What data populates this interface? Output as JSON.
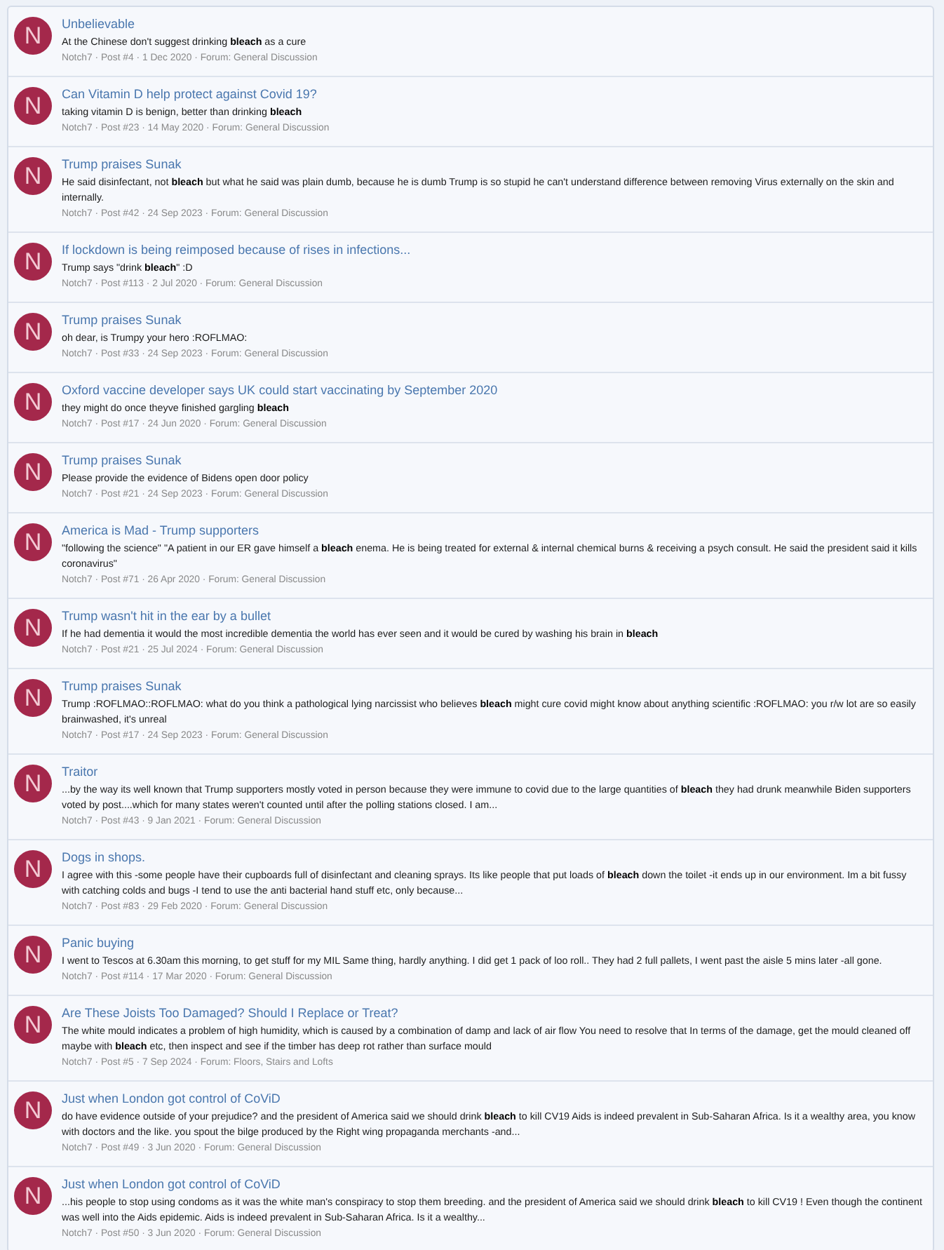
{
  "results": [
    {
      "avatar": "N",
      "title": "Unbelievable",
      "snippet": "At the Chinese don't suggest drinking **bleach** as a cure",
      "meta": "Notch7 · Post #4 · 1 Dec 2020 · Forum: General Discussion"
    },
    {
      "avatar": "N",
      "title": "Can Vitamin D help protect against Covid 19?",
      "snippet": "taking vitamin D is benign, better than drinking **bleach**",
      "meta": "Notch7 · Post #23 · 14 May 2020 · Forum: General Discussion"
    },
    {
      "avatar": "N",
      "title": "Trump praises Sunak",
      "snippet": "He said disinfectant, not **bleach** but what he said was plain dumb, because he is dumb Trump is so stupid he can't understand difference between removing Virus externally on the skin and internally.",
      "meta": "Notch7 · Post #42 · 24 Sep 2023 · Forum: General Discussion"
    },
    {
      "avatar": "N",
      "title": "If lockdown is being reimposed because of rises in infections...",
      "snippet": "Trump says \"drink **bleach**\" :D",
      "meta": "Notch7 · Post #113 · 2 Jul 2020 · Forum: General Discussion"
    },
    {
      "avatar": "N",
      "title": "Trump praises Sunak",
      "snippet": "oh dear, is Trumpy your hero :ROFLMAO:",
      "meta": "Notch7 · Post #33 · 24 Sep 2023 · Forum: General Discussion"
    },
    {
      "avatar": "N",
      "title": "Oxford vaccine developer says UK could start vaccinating by September 2020",
      "snippet": "they might do once theyve finished gargling **bleach**",
      "meta": "Notch7 · Post #17 · 24 Jun 2020 · Forum: General Discussion"
    },
    {
      "avatar": "N",
      "title": "Trump praises Sunak",
      "snippet": "Please provide the evidence of Bidens open door policy",
      "meta": "Notch7 · Post #21 · 24 Sep 2023 · Forum: General Discussion"
    },
    {
      "avatar": "N",
      "title": "America is Mad - Trump supporters",
      "snippet": "\"following the science\" \"A patient in our ER gave himself a **bleach** enema. He is being treated for external & internal chemical burns & receiving a psych consult. He said the president said it kills coronavirus\"",
      "meta": "Notch7 · Post #71 · 26 Apr 2020 · Forum: General Discussion"
    },
    {
      "avatar": "N",
      "title": "Trump wasn't hit in the ear by a bullet",
      "snippet": "If he had dementia it would the most incredible dementia the world has ever seen and it would be cured by washing his brain in **bleach**",
      "meta": "Notch7 · Post #21 · 25 Jul 2024 · Forum: General Discussion"
    },
    {
      "avatar": "N",
      "title": "Trump praises Sunak",
      "snippet": "Trump :ROFLMAO::ROFLMAO: what do you think a pathological lying narcissist who believes **bleach** might cure covid might know about anything scientific :ROFLMAO: you r/w lot are so easily brainwashed, it's unreal",
      "meta": "Notch7 · Post #17 · 24 Sep 2023 · Forum: General Discussion"
    },
    {
      "avatar": "N",
      "title": "Traitor",
      "snippet": "...by the way its well known that Trump supporters mostly voted in person because they were immune to covid due to the large quantities of **bleach** they had drunk meanwhile Biden supporters voted by post....which for many states weren't counted until after the polling stations closed. I am...",
      "meta": "Notch7 · Post #43 · 9 Jan 2021 · Forum: General Discussion"
    },
    {
      "avatar": "N",
      "title": "Dogs in shops.",
      "snippet": "I agree with this -some people have their cupboards full of disinfectant and cleaning sprays. Its like people that put loads of **bleach** down the toilet -it ends up in our environment. Im a bit fussy with catching colds and bugs -I tend to use the anti bacterial hand stuff etc, only because...",
      "meta": "Notch7 · Post #83 · 29 Feb 2020 · Forum: General Discussion"
    },
    {
      "avatar": "N",
      "title": "Panic buying",
      "snippet": "I went to Tescos at 6.30am this morning, to get stuff for my MIL Same thing, hardly anything. I did get 1 pack of loo roll.. They had 2 full pallets, I went past the aisle 5 mins later -all gone.",
      "meta": "Notch7 · Post #114 · 17 Mar 2020 · Forum: General Discussion"
    },
    {
      "avatar": "N",
      "title": "Are These Joists Too Damaged? Should I Replace or Treat?",
      "snippet": "The white mould indicates a problem of high humidity, which is caused by a combination of damp and lack of air flow You need to resolve that In terms of the damage, get the mould cleaned off maybe with **bleach** etc, then inspect and see if the timber has deep rot rather than surface mould",
      "meta": "Notch7 · Post #5 · 7 Sep 2024 · Forum: Floors, Stairs and Lofts"
    },
    {
      "avatar": "N",
      "title": "Just when London got control of CoViD",
      "snippet": "do have evidence outside of your prejudice? and the president of America said we should drink **bleach** to kill CV19 Aids is indeed prevalent in Sub-Saharan Africa. Is it a wealthy area, you know with doctors and the like. you spout the bilge produced by the Right wing propaganda merchants -and...",
      "meta": "Notch7 · Post #49 · 3 Jun 2020 · Forum: General Discussion"
    },
    {
      "avatar": "N",
      "title": "Just when London got control of CoViD",
      "snippet": "...his people to stop using condoms as it was the white man's conspiracy to stop them breeding. and the president of America said we should drink **bleach** to kill CV19 ! Even though the continent was well into the Aids epidemic. Aids is indeed prevalent in Sub-Saharan Africa. Is it a wealthy...",
      "meta": "Notch7 · Post #50 · 3 Jun 2020 · Forum: General Discussion"
    }
  ]
}
